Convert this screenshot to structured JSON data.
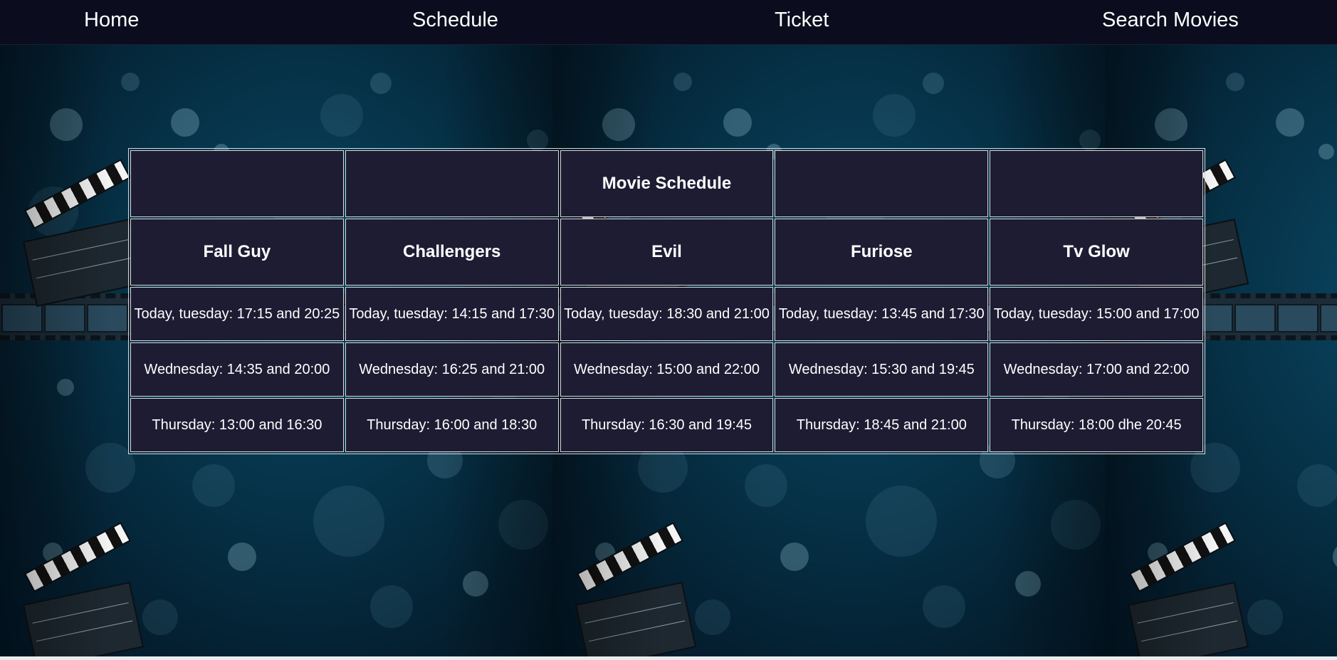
{
  "nav": {
    "home": "Home",
    "schedule": "Schedule",
    "ticket": "Ticket",
    "search_movies": "Search Movies"
  },
  "table": {
    "title": "Movie Schedule",
    "movies": [
      "Fall Guy",
      "Challengers",
      "Evil",
      "Furiose",
      "Tv Glow"
    ],
    "rows": [
      [
        "Today, tuesday: 17:15 and 20:25",
        "Today, tuesday: 14:15 and 17:30",
        "Today, tuesday: 18:30 and 21:00",
        "Today, tuesday: 13:45 and 17:30",
        "Today, tuesday: 15:00 and 17:00"
      ],
      [
        "Wednesday: 14:35 and 20:00",
        "Wednesday: 16:25 and 21:00",
        "Wednesday: 15:00 and 22:00",
        "Wednesday: 15:30 and 19:45",
        "Wednesday: 17:00 and 22:00"
      ],
      [
        "Thursday: 13:00 and 16:30",
        "Thursday: 16:00 and 18:30",
        "Thursday: 16:30 and 19:45",
        "Thursday: 18:45 and 21:00",
        "Thursday: 18:00 dhe 20:45"
      ]
    ]
  },
  "colors": {
    "nav_background": "#0b0c1d",
    "cell_background": "#1d1c33",
    "cell_border": "#d8d8d8",
    "text": "#ffffff",
    "page_background": "#063349"
  },
  "background": {
    "icons": [
      "clapperboard-icon",
      "filmstrip-icon",
      "bokeh-lights"
    ]
  }
}
